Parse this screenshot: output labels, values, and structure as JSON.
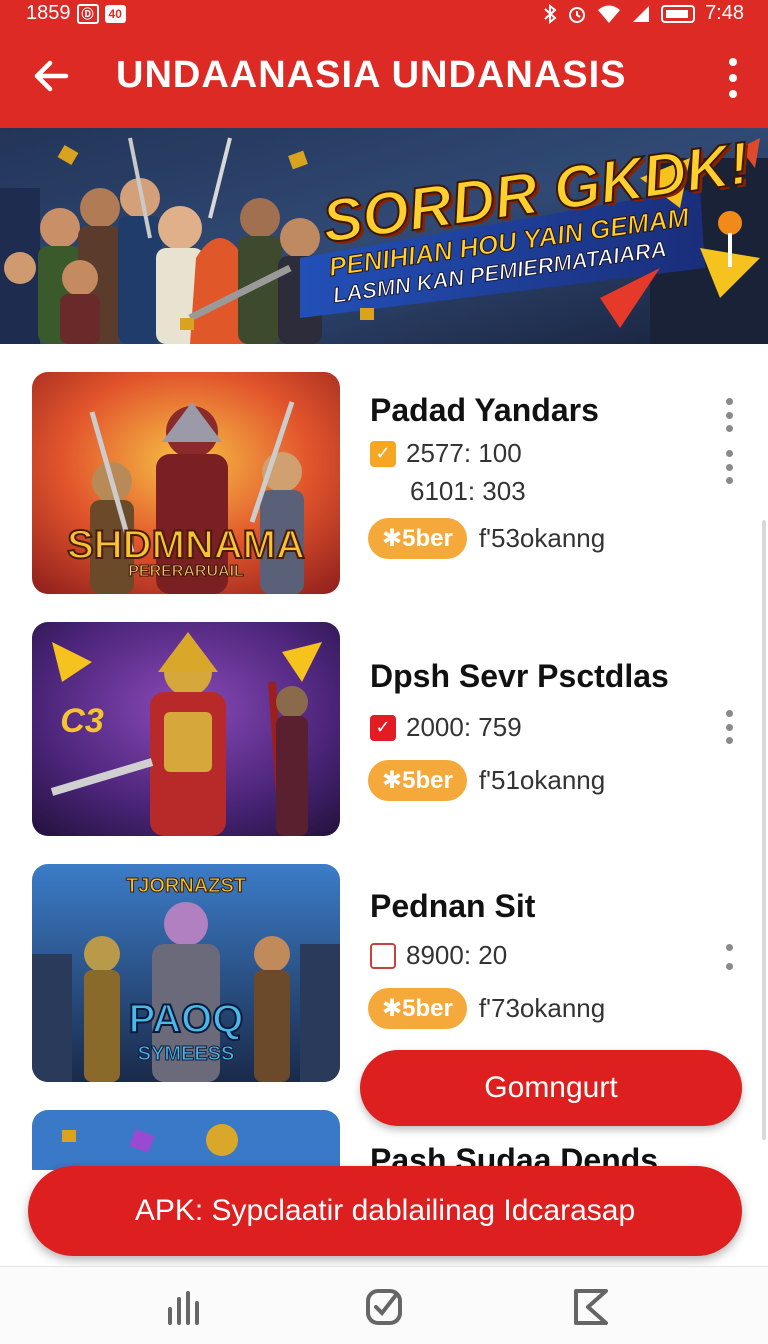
{
  "status_bar": {
    "time_left": "1859",
    "badge_1": "Ⓓ",
    "badge_2": "40",
    "time_right": "7:48",
    "icons": [
      "bluetooth-icon",
      "alarm-icon",
      "wifi-icon",
      "signal-icon",
      "battery-icon"
    ]
  },
  "app_bar": {
    "title": "UNDAANASIA UNDANASIS",
    "back_icon": "arrow-left-icon",
    "menu_icon": "more-vert-icon"
  },
  "banner": {
    "headline": "SORDR GKDK!",
    "line1": "PENIHIAN HOU YAIN GEMAM",
    "line2": "LASMN KAN PEMIERMATAIARA"
  },
  "items": [
    {
      "title": "Padad Yandars",
      "thumb_caption": "SHDMNAMA",
      "thumb_sub": "PERERARUAIL",
      "stat_1": "2577: 100",
      "stat_2": "6101: 303",
      "checkbox": "checked-orange",
      "tag": "✱5ber",
      "tag_text": "f'53okanng"
    },
    {
      "title": "Dpsh Sevr Psctdlas",
      "thumb_caption": "C3",
      "stat_1": "2000: 759",
      "checkbox": "checked-red",
      "tag": "✱5ber",
      "tag_text": "f'51okanng"
    },
    {
      "title": "Pednan Sit",
      "thumb_caption": "PAOQ",
      "thumb_sub": "SYMEESS",
      "thumb_top": "TJORNAZST",
      "stat_1": "8900: 20",
      "checkbox": "unchecked",
      "tag": "✱5ber",
      "tag_text": "f'73okanng"
    },
    {
      "title": "Pash Sudaa Dends"
    }
  ],
  "cta_button": "Gomngurt",
  "apk_bar": "APK: Sypclaatir dablailinag Idcarasap",
  "nav": {
    "recents_icon": "recents-icon",
    "home_icon": "home-icon",
    "back_icon": "back-icon"
  },
  "colors": {
    "primary_red": "#de2a25",
    "tag_orange": "#f5a93a",
    "checkbox_orange": "#f5a623",
    "checkbox_red": "#e31b23"
  }
}
